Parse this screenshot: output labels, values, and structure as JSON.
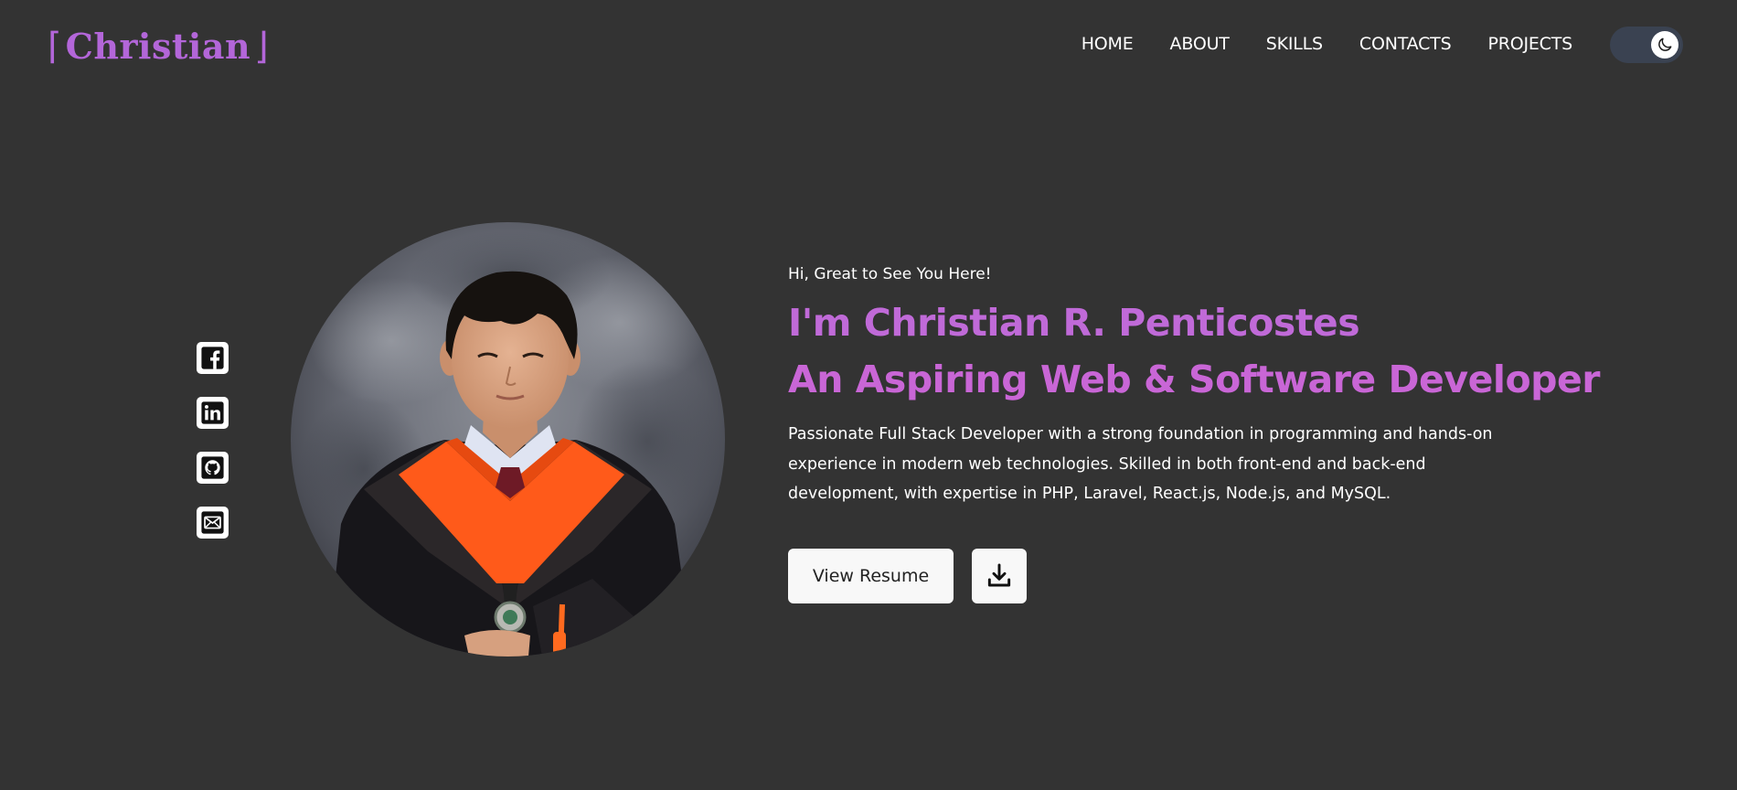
{
  "header": {
    "logo_text": "Christian",
    "nav": [
      {
        "label": "HOME"
      },
      {
        "label": "ABOUT"
      },
      {
        "label": "SKILLS"
      },
      {
        "label": "CONTACTS"
      },
      {
        "label": "PROJECTS"
      }
    ],
    "theme_toggle": {
      "icon": "moon-icon",
      "state": "dark"
    }
  },
  "socials": [
    {
      "icon": "facebook-icon"
    },
    {
      "icon": "linkedin-icon"
    },
    {
      "icon": "github-icon"
    },
    {
      "icon": "mail-icon"
    }
  ],
  "hero": {
    "greeting": "Hi, Great to See You Here!",
    "headline_line1": "I'm Christian R. Penticostes",
    "headline_line2": "An Aspiring Web & Software Developer",
    "bio": "Passionate Full Stack Developer with a strong foundation in programming and hands-on experience in modern web technologies. Skilled in both front-end and back-end development, with expertise in PHP, Laravel, React.js, Node.js, and MySQL.",
    "resume_button": "View Resume",
    "download_icon": "download-icon"
  },
  "colors": {
    "background": "#333333",
    "accent": "#b366d9",
    "toggle_track": "#3a4251",
    "gown_orange": "#ff5a1a"
  }
}
